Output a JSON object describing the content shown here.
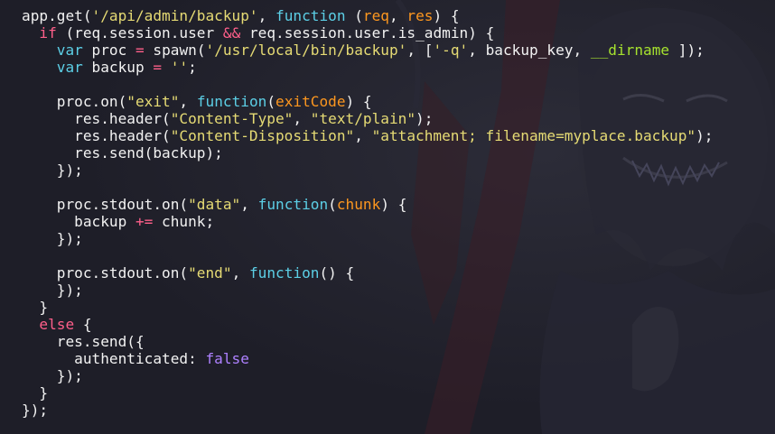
{
  "colors": {
    "background": "#1e1e28",
    "plain": "#f2f2f2",
    "keyword": "#ff5f8a",
    "function": "#5ccfe6",
    "string": "#e6db74",
    "parameter": "#fd971f",
    "operator": "#ff5f8a",
    "boolean": "#ae81ff",
    "global": "#a6e22e"
  },
  "editor": {
    "language": "javascript",
    "background_art": "dark anime-style character illustration",
    "lines": [
      [
        [
          "plain",
          "app.get("
        ],
        [
          "str",
          "'/api/admin/backup'"
        ],
        [
          "plain",
          ", "
        ],
        [
          "fn",
          "function"
        ],
        [
          "plain",
          " ("
        ],
        [
          "param",
          "req"
        ],
        [
          "plain",
          ", "
        ],
        [
          "param",
          "res"
        ],
        [
          "plain",
          ") {"
        ]
      ],
      [
        [
          "plain",
          "  "
        ],
        [
          "kw",
          "if"
        ],
        [
          "plain",
          " (req.session.user "
        ],
        [
          "op",
          "&&"
        ],
        [
          "plain",
          " req.session.user.is_admin) {"
        ]
      ],
      [
        [
          "plain",
          "    "
        ],
        [
          "fn",
          "var"
        ],
        [
          "plain",
          " proc "
        ],
        [
          "op",
          "="
        ],
        [
          "plain",
          " spawn("
        ],
        [
          "str",
          "'/usr/local/bin/backup'"
        ],
        [
          "plain",
          ", ["
        ],
        [
          "str",
          "'-q'"
        ],
        [
          "plain",
          ", backup_key, "
        ],
        [
          "global",
          "__dirname"
        ],
        [
          "plain",
          " ]);"
        ]
      ],
      [
        [
          "plain",
          "    "
        ],
        [
          "fn",
          "var"
        ],
        [
          "plain",
          " backup "
        ],
        [
          "op",
          "="
        ],
        [
          "plain",
          " "
        ],
        [
          "str",
          "''"
        ],
        [
          "plain",
          ";"
        ]
      ],
      [],
      [
        [
          "plain",
          "    proc.on("
        ],
        [
          "str",
          "\"exit\""
        ],
        [
          "plain",
          ", "
        ],
        [
          "fn",
          "function"
        ],
        [
          "plain",
          "("
        ],
        [
          "param",
          "exitCode"
        ],
        [
          "plain",
          ") {"
        ]
      ],
      [
        [
          "plain",
          "      res.header("
        ],
        [
          "str",
          "\"Content-Type\""
        ],
        [
          "plain",
          ", "
        ],
        [
          "str",
          "\"text/plain\""
        ],
        [
          "plain",
          ");"
        ]
      ],
      [
        [
          "plain",
          "      res.header("
        ],
        [
          "str",
          "\"Content-Disposition\""
        ],
        [
          "plain",
          ", "
        ],
        [
          "str",
          "\"attachment; filename=myplace.backup\""
        ],
        [
          "plain",
          ");"
        ]
      ],
      [
        [
          "plain",
          "      res.send(backup);"
        ]
      ],
      [
        [
          "plain",
          "    });"
        ]
      ],
      [],
      [
        [
          "plain",
          "    proc.stdout.on("
        ],
        [
          "str",
          "\"data\""
        ],
        [
          "plain",
          ", "
        ],
        [
          "fn",
          "function"
        ],
        [
          "plain",
          "("
        ],
        [
          "param",
          "chunk"
        ],
        [
          "plain",
          ") {"
        ]
      ],
      [
        [
          "plain",
          "      backup "
        ],
        [
          "op",
          "+="
        ],
        [
          "plain",
          " chunk;"
        ]
      ],
      [
        [
          "plain",
          "    });"
        ]
      ],
      [],
      [
        [
          "plain",
          "    proc.stdout.on("
        ],
        [
          "str",
          "\"end\""
        ],
        [
          "plain",
          ", "
        ],
        [
          "fn",
          "function"
        ],
        [
          "plain",
          "() {"
        ]
      ],
      [
        [
          "plain",
          "    });"
        ]
      ],
      [
        [
          "plain",
          "  }"
        ]
      ],
      [
        [
          "plain",
          "  "
        ],
        [
          "kw",
          "else"
        ],
        [
          "plain",
          " {"
        ]
      ],
      [
        [
          "plain",
          "    res.send({"
        ]
      ],
      [
        [
          "plain",
          "      authenticated: "
        ],
        [
          "bool",
          "false"
        ]
      ],
      [
        [
          "plain",
          "    });"
        ]
      ],
      [
        [
          "plain",
          "  }"
        ]
      ],
      [
        [
          "plain",
          "});"
        ]
      ]
    ]
  }
}
